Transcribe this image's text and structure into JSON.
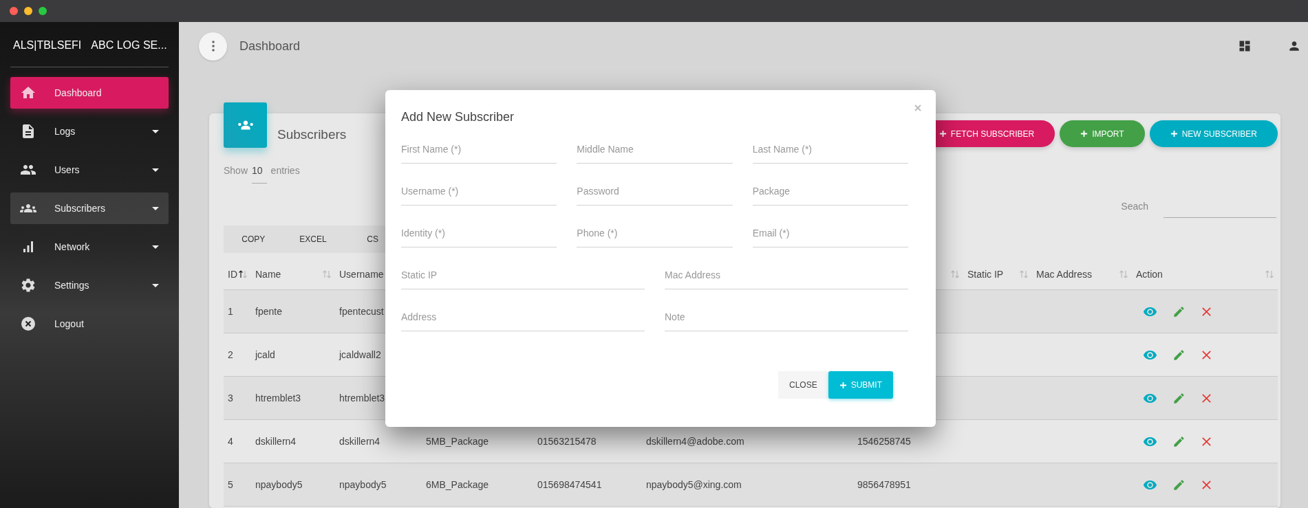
{
  "window_controls": [
    {
      "color": "#ff5f57"
    },
    {
      "color": "#febc2e"
    },
    {
      "color": "#28c840"
    }
  ],
  "sidebar": {
    "brand_short": "ALS|TBLSEFI",
    "brand": "ABC LOG SE...",
    "items": [
      {
        "label": "Dashboard",
        "selected": true,
        "highlighted": false,
        "expandable": false
      },
      {
        "label": "Logs",
        "selected": false,
        "highlighted": false,
        "expandable": true
      },
      {
        "label": "Users",
        "selected": false,
        "highlighted": false,
        "expandable": true
      },
      {
        "label": "Subscribers",
        "selected": false,
        "highlighted": true,
        "expandable": true
      },
      {
        "label": "Network",
        "selected": false,
        "highlighted": false,
        "expandable": true
      },
      {
        "label": "Settings",
        "selected": false,
        "highlighted": false,
        "expandable": true
      },
      {
        "label": "Logout",
        "selected": false,
        "highlighted": false,
        "expandable": false
      }
    ]
  },
  "topbar": {
    "title": "Dashboard"
  },
  "card": {
    "title": "Subscribers",
    "actions": [
      {
        "label": "FETCH SUBSCRIBER",
        "color": "#d81b60"
      },
      {
        "label": "IMPORT",
        "color": "#43a047"
      },
      {
        "label": "NEW SUBSCRIBER",
        "color": "#00acc1"
      }
    ],
    "length": {
      "prefix": "Show",
      "value": "10",
      "suffix": "entries"
    },
    "search": {
      "label": "Seach"
    },
    "export_buttons": [
      "COPY",
      "EXCEL",
      "CS"
    ],
    "table": {
      "columns": [
        {
          "label": "ID",
          "sorted": true
        },
        {
          "label": "Name",
          "sorted": false
        },
        {
          "label": "Username"
        },
        {},
        {},
        {},
        {
          "sorted": false
        },
        {
          "label": "Static IP",
          "sorted": false
        },
        {
          "label": "Mac Address",
          "sorted": false
        },
        {
          "label": "Action",
          "sorted": false
        }
      ],
      "rows": [
        {
          "id": "1",
          "name": "fpente",
          "username": "fpentecust"
        },
        {
          "id": "2",
          "name": "jcald",
          "username": "jcaldwall2"
        },
        {
          "id": "3",
          "name": "htremblet3",
          "username": "htremblet3"
        },
        {
          "id": "4",
          "name": "dskillern4",
          "username": "dskillern4",
          "package": "5MB_Package",
          "phone": "01563215478",
          "email": "dskillern4@adobe.com",
          "identity": "1546258745"
        },
        {
          "id": "5",
          "name": "npaybody5",
          "username": "npaybody5",
          "package": "6MB_Package",
          "phone": "015698474541",
          "email": "npaybody5@xing.com",
          "identity": "9856478951"
        }
      ]
    }
  },
  "modal": {
    "title": "Add New Subscriber",
    "field_rows": [
      [
        {
          "placeholder": "First Name (*)"
        },
        {
          "placeholder": "Middle Name"
        },
        {
          "placeholder": "Last Name (*)"
        }
      ],
      [
        {
          "placeholder": "Username (*)"
        },
        {
          "placeholder": "Password"
        },
        {
          "placeholder": "Package"
        }
      ],
      [
        {
          "placeholder": "Identity (*)"
        },
        {
          "placeholder": "Phone (*)"
        },
        {
          "placeholder": "Email (*)"
        }
      ],
      [
        {
          "placeholder": "Static IP"
        },
        {
          "placeholder": "Mac Address"
        }
      ],
      [
        {
          "placeholder": "Address"
        },
        {
          "placeholder": "Note"
        }
      ]
    ],
    "buttons": [
      {
        "label": "CLOSE",
        "kind": "flat"
      },
      {
        "label": "SUBMIT",
        "kind": "primary"
      }
    ]
  }
}
